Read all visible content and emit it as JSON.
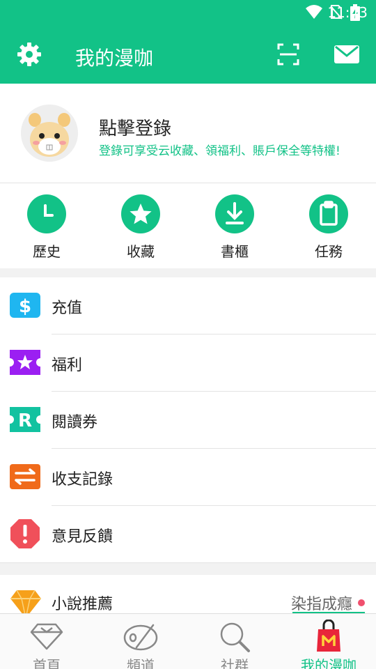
{
  "status_bar": {
    "time": "11:43"
  },
  "toolbar": {
    "title": "我的漫咖"
  },
  "profile": {
    "login_title": "點擊登錄",
    "login_subtitle": "登錄可享受云收藏、領福利、賬戶保全等特權!"
  },
  "quick_actions": [
    {
      "label": "歷史",
      "icon": "clock-icon"
    },
    {
      "label": "收藏",
      "icon": "star-icon"
    },
    {
      "label": "書櫃",
      "icon": "download-icon"
    },
    {
      "label": "任務",
      "icon": "clipboard-icon"
    }
  ],
  "menu": [
    {
      "label": "充值",
      "icon": "dollar-icon",
      "color": "#1fb6f0"
    },
    {
      "label": "福利",
      "icon": "ticket-star-icon",
      "color": "#9b1ff2"
    },
    {
      "label": "閱讀券",
      "icon": "ticket-r-icon",
      "color": "#12c2a0"
    },
    {
      "label": "收支記錄",
      "icon": "transfer-icon",
      "color": "#f06a1a"
    },
    {
      "label": "意見反饋",
      "icon": "alert-octagon-icon",
      "color": "#f0505a"
    }
  ],
  "novel": {
    "label": "小說推薦",
    "right_text": "染指成癮",
    "icon": "diamond-icon"
  },
  "tabs": [
    {
      "label": "首頁",
      "icon": "diamond-outline-icon",
      "active": false
    },
    {
      "label": "頻道",
      "icon": "palette-icon",
      "active": false
    },
    {
      "label": "社群",
      "icon": "magnifier-icon",
      "active": false
    },
    {
      "label": "我的漫咖",
      "icon": "shopping-bag-icon",
      "active": true
    }
  ],
  "colors": {
    "accent": "#12c287"
  }
}
